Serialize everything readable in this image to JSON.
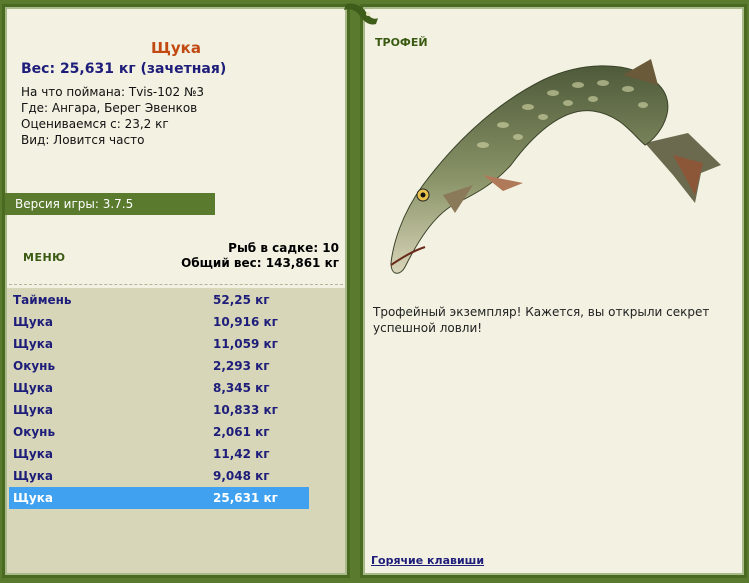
{
  "fish_card": {
    "name": "Щука",
    "weight": "Вес: 25,631 кг (зачетная)",
    "bait": "На что поймана: Tvis-102 №3",
    "location": "Где: Ангара, Берег Эвенков",
    "evaluated": "Оцениваемся с: 23,2 кг",
    "kind": "Вид: Ловится часто"
  },
  "version": "Версия игры: 3.7.5",
  "menu_label": "МЕНЮ",
  "stats": {
    "count": "Рыб в садке: 10",
    "total": "Общий вес: 143,861 кг"
  },
  "catch_list": [
    {
      "name": "Таймень",
      "weight": "52,25 кг"
    },
    {
      "name": "Щука",
      "weight": "10,916 кг"
    },
    {
      "name": "Щука",
      "weight": "11,059 кг"
    },
    {
      "name": "Окунь",
      "weight": "2,293 кг"
    },
    {
      "name": "Щука",
      "weight": "8,345 кг"
    },
    {
      "name": "Щука",
      "weight": "10,833 кг"
    },
    {
      "name": "Окунь",
      "weight": "2,061 кг"
    },
    {
      "name": "Щука",
      "weight": "11,42 кг"
    },
    {
      "name": "Щука",
      "weight": "9,048 кг"
    },
    {
      "name": "Щука",
      "weight": "25,631 кг"
    }
  ],
  "selected_index": 9,
  "trophy": {
    "label": "ТРОФЕЙ",
    "description": "Трофейный экземпляр! Кажется, вы открыли секрет успешной ловли!"
  },
  "hotkeys": "Горячие клавиши",
  "colors": {
    "frame": "#5a7a2e",
    "panel": "#f2f1e2",
    "list_bg": "#d7d6b9",
    "selected": "#3fa1f0",
    "name_accent": "#c24a12",
    "text_blue": "#1e1e7a"
  }
}
